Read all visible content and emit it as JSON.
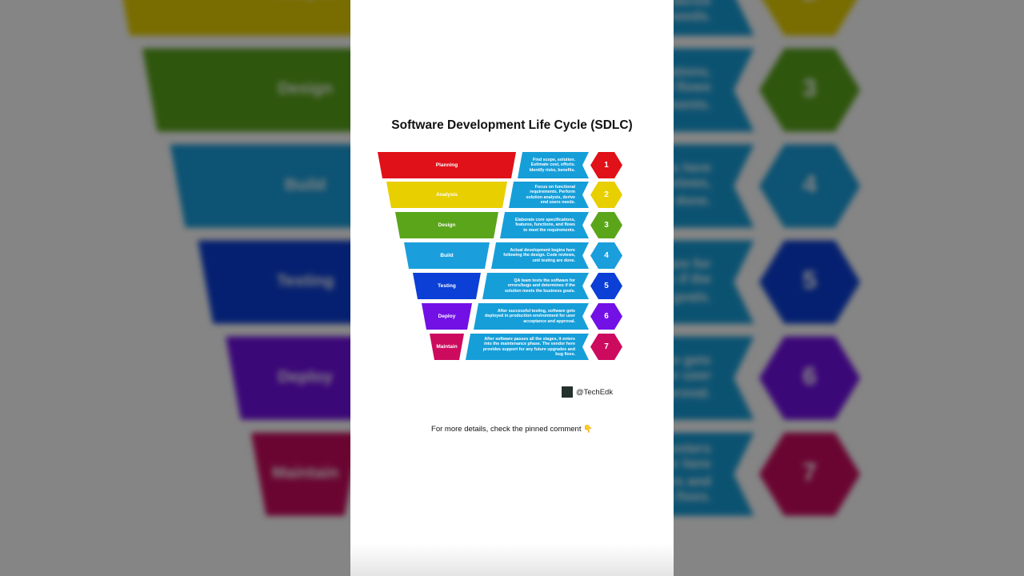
{
  "title": "Software Development Life Cycle (SDLC)",
  "stages": [
    {
      "name": "Planning",
      "number": "1",
      "color": "#e01119",
      "description": "Find scope, solution. Estimate cost, efforts. Identify risks, benefits."
    },
    {
      "name": "Analysis",
      "number": "2",
      "color": "#e8cf00",
      "description": "Focus on functional requirements. Perform solution analysis, derive end users needs."
    },
    {
      "name": "Design",
      "number": "3",
      "color": "#5aa51a",
      "description": "Elaborate core specifications, features, functions, and flows to meet the requirements."
    },
    {
      "name": "Build",
      "number": "4",
      "color": "#1a9fdc",
      "description": "Actual development begins here following the design. Code reviews, unit testing are done."
    },
    {
      "name": "Testing",
      "number": "5",
      "color": "#0b3fd6",
      "description": "QA team tests the software for errors/bugs and determines if the solution meets the business goals."
    },
    {
      "name": "Deploy",
      "number": "6",
      "color": "#7210e6",
      "description": "After successful testing, software gets deployed in production environment for user acceptance and approval."
    },
    {
      "name": "Maintain",
      "number": "7",
      "color": "#cc0b5f",
      "description": "After software passes all the stages, it enters into the maintenance phase. The vendor here provides support for any future upgrades and bug fixes."
    }
  ],
  "credit": {
    "logo_text": "TECH EDK",
    "handle": "@TechEdk"
  },
  "caption": {
    "text": "For more details, check the pinned comment",
    "emoji": "👇"
  },
  "description_color": "#169ed9"
}
